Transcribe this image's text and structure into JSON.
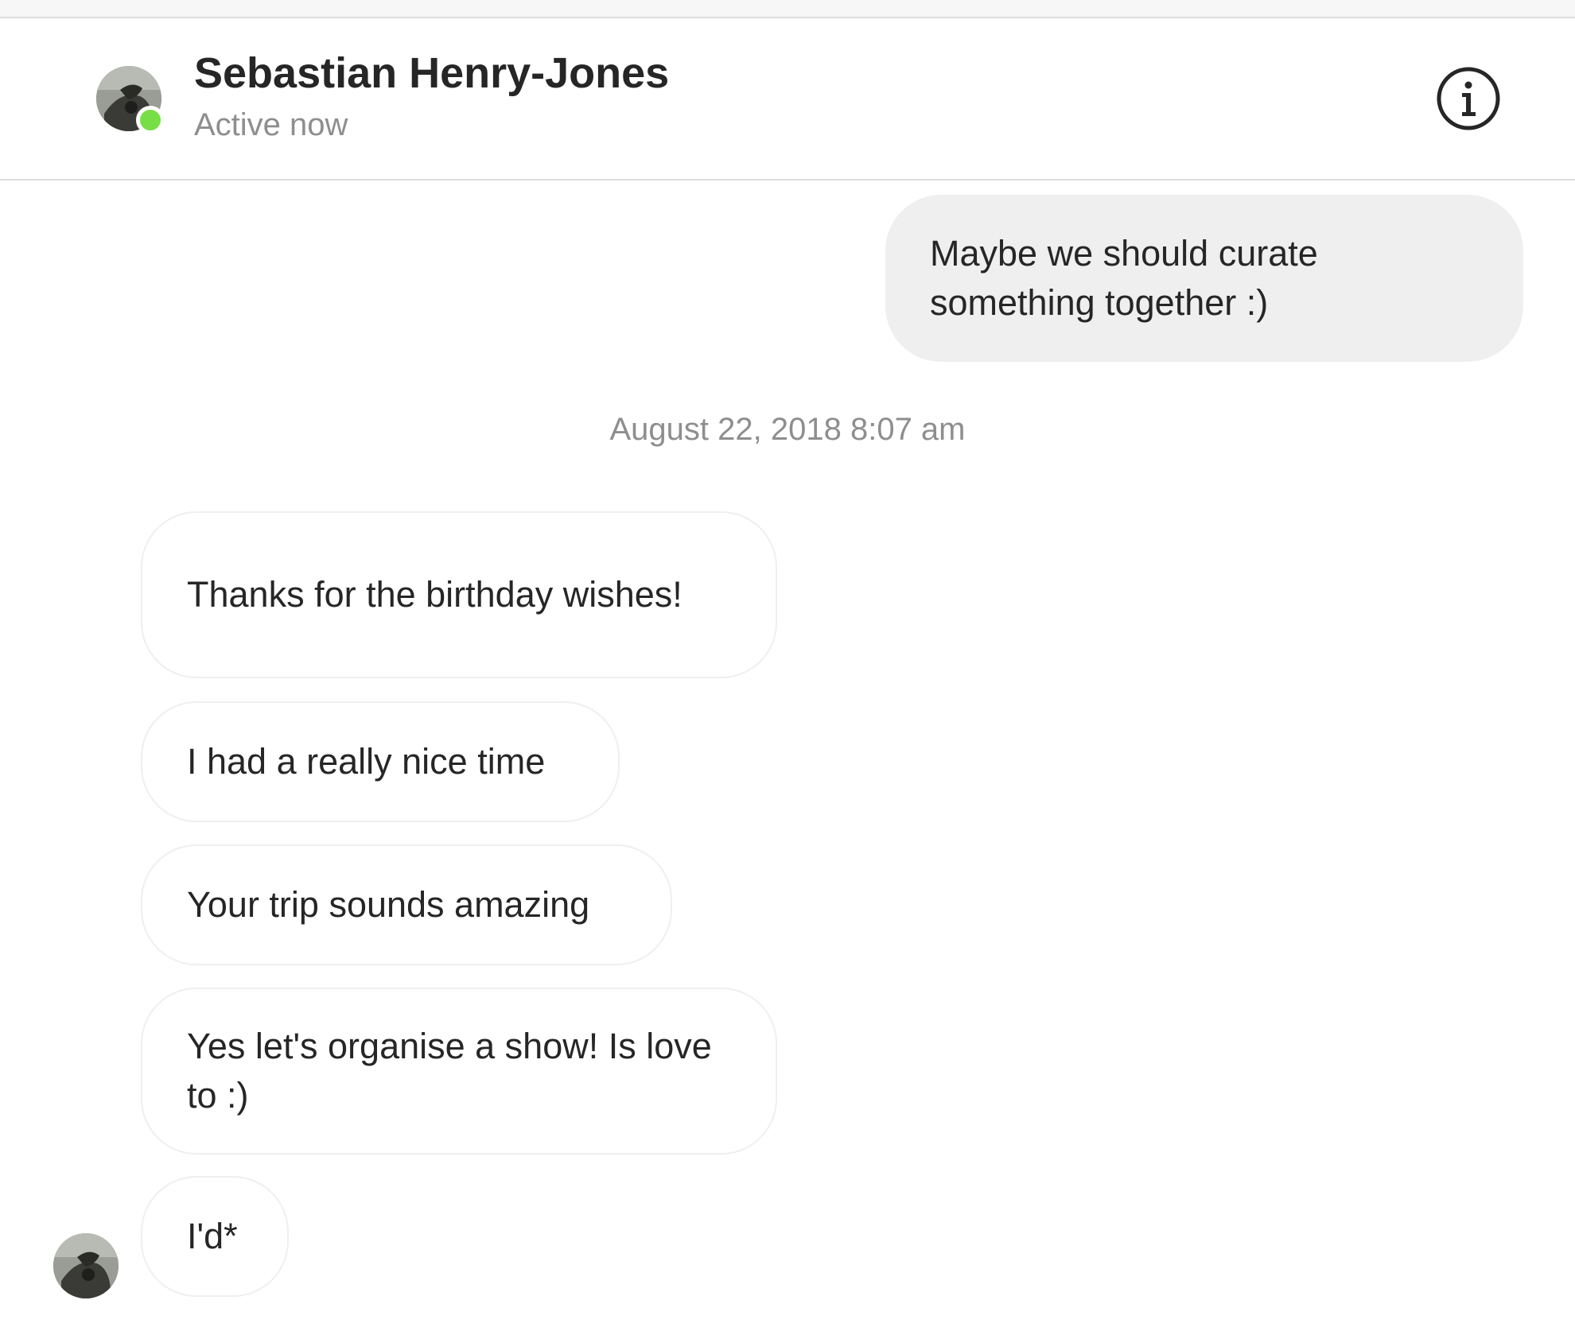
{
  "header": {
    "contact_name": "Sebastian Henry-Jones",
    "status": "Active now",
    "status_indicator_color": "#78de45",
    "info_icon": "info-icon",
    "avatar_icon": "avatar"
  },
  "conversation": {
    "messages_before": [
      {
        "direction": "sent",
        "text": "Maybe we should curate something together :)"
      }
    ],
    "timestamp": "August 22, 2018 8:07 am",
    "messages_after": [
      {
        "direction": "received",
        "text": "Thanks for the birthday wishes!"
      },
      {
        "direction": "received",
        "text": "I had a really nice time"
      },
      {
        "direction": "received",
        "text": "Your trip sounds amazing"
      },
      {
        "direction": "received",
        "text": "Yes let's organise a show! Is love to :)"
      },
      {
        "direction": "received",
        "text": "I'd*"
      }
    ]
  },
  "colors": {
    "sent_bubble": "#efefef",
    "received_border": "#efefef",
    "text": "#262626",
    "secondary_text": "#8e8e8e"
  }
}
